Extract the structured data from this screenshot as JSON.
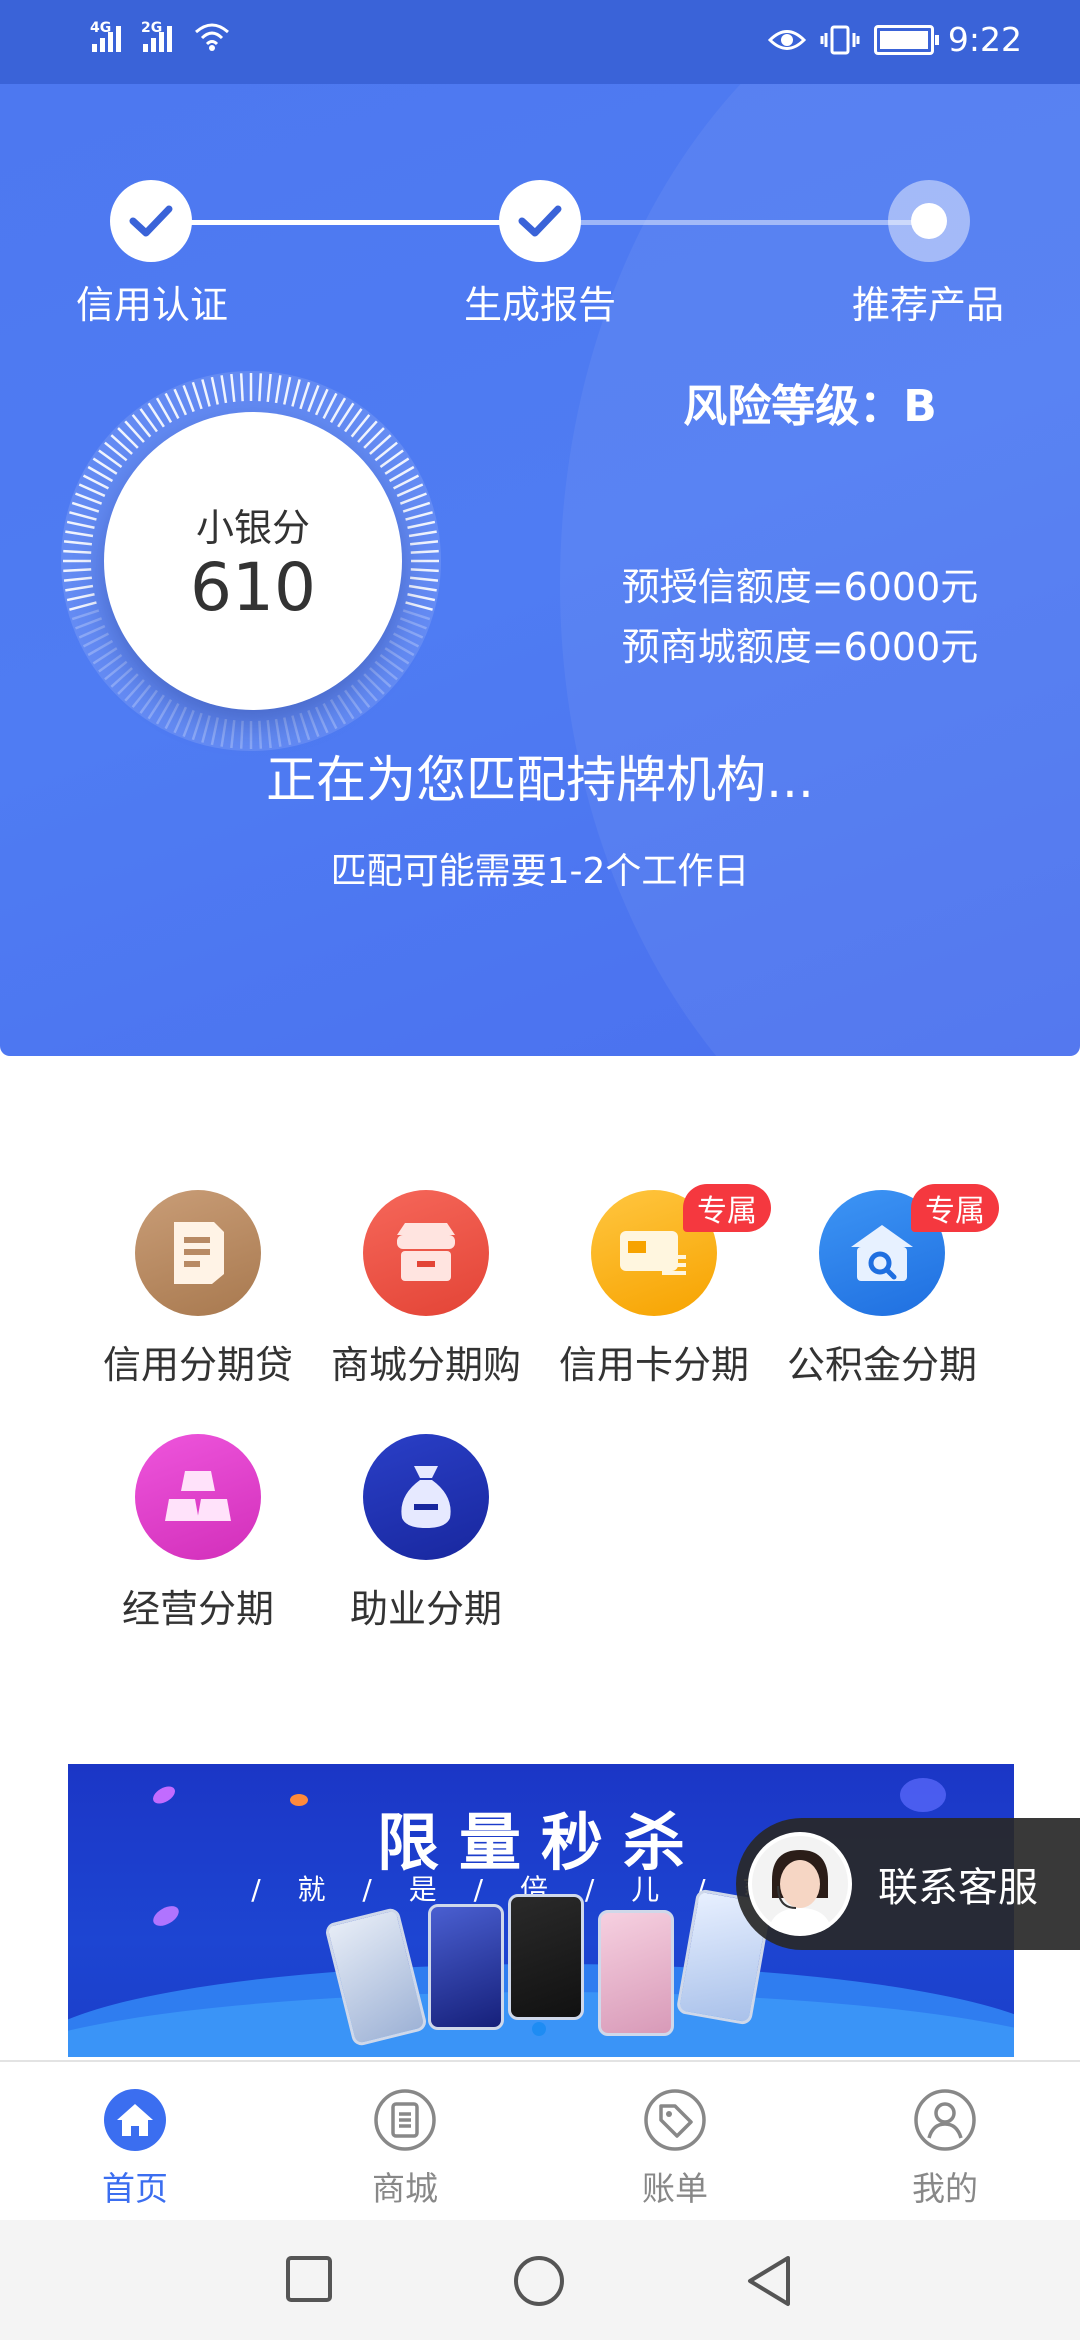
{
  "status_bar": {
    "time": "9:22",
    "net1": "4G",
    "net2": "2G"
  },
  "steps": [
    {
      "label": "信用认证",
      "state": "done"
    },
    {
      "label": "生成报告",
      "state": "done"
    },
    {
      "label": "推荐产品",
      "state": "current"
    }
  ],
  "score": {
    "title": "小银分",
    "value": "610"
  },
  "risk": {
    "label": "风险等级：B"
  },
  "quotas": [
    {
      "text": "预授信额度=6000元"
    },
    {
      "text": "预商城额度=6000元"
    }
  ],
  "matching": {
    "title": "正在为您匹配持牌机构...",
    "subtitle": "匹配可能需要1-2个工作日"
  },
  "products": [
    {
      "label": "信用分期贷",
      "icon": "document-icon",
      "color": "#b88a64",
      "tag": ""
    },
    {
      "label": "商城分期购",
      "icon": "store-icon",
      "color": "#ef5547",
      "tag": ""
    },
    {
      "label": "信用卡分期",
      "icon": "credit-card-icon",
      "color": "#ffb416",
      "tag": "专属"
    },
    {
      "label": "公积金分期",
      "icon": "house-search-icon",
      "color": "#2d83ec",
      "tag": "专属"
    },
    {
      "label": "经营分期",
      "icon": "gold-bars-icon",
      "color": "#e33fcc",
      "tag": ""
    },
    {
      "label": "助业分期",
      "icon": "money-bag-icon",
      "color": "#2233b6",
      "tag": ""
    }
  ],
  "banner": {
    "title": "限量秒杀",
    "subtitle": "/ 就 / 是 / 倍 / 儿 / 爽 /"
  },
  "support": {
    "label": "联系客服"
  },
  "bottom_nav": [
    {
      "label": "首页",
      "icon": "home-icon",
      "active": true
    },
    {
      "label": "商城",
      "icon": "mall-icon",
      "active": false
    },
    {
      "label": "账单",
      "icon": "bill-tag-icon",
      "active": false
    },
    {
      "label": "我的",
      "icon": "profile-icon",
      "active": false
    }
  ],
  "colors": {
    "primary": "#4f7cf3",
    "tag_red": "#f5383f",
    "nav_active": "#3b6ef0"
  }
}
